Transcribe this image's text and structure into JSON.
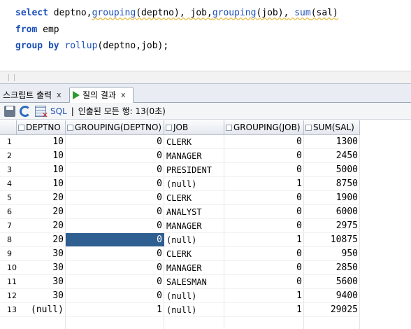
{
  "editor": {
    "line1": {
      "select": "select",
      "p1": " deptno,",
      "grouping1": "grouping",
      "p2": "(deptno),",
      "p3": " job,",
      "grouping2": "grouping",
      "p4": "(job),",
      "sum": " sum",
      "p5": "(sal)"
    },
    "line2": {
      "from": "from",
      "rest": " emp"
    },
    "line3": {
      "group_by": "group by",
      "rollup": " rollup",
      "rest": "(deptno,job);"
    }
  },
  "tabs": {
    "script_output": "스크립트 출력",
    "query_result": "질의 결과",
    "close": "x"
  },
  "toolbar": {
    "sql_label": "SQL",
    "separator": "|",
    "status": "인출된 모든 행: 13(0초)"
  },
  "grid": {
    "columns": [
      "DEPTNO",
      "GROUPING(DEPTNO)",
      "JOB",
      "GROUPING(JOB)",
      "SUM(SAL)"
    ],
    "rows": [
      {
        "n": "1",
        "deptno": "10",
        "gd": "0",
        "job": "CLERK",
        "gj": "0",
        "sum": "1300"
      },
      {
        "n": "2",
        "deptno": "10",
        "gd": "0",
        "job": "MANAGER",
        "gj": "0",
        "sum": "2450"
      },
      {
        "n": "3",
        "deptno": "10",
        "gd": "0",
        "job": "PRESIDENT",
        "gj": "0",
        "sum": "5000"
      },
      {
        "n": "4",
        "deptno": "10",
        "gd": "0",
        "job": "(null)",
        "gj": "1",
        "sum": "8750"
      },
      {
        "n": "5",
        "deptno": "20",
        "gd": "0",
        "job": "CLERK",
        "gj": "0",
        "sum": "1900"
      },
      {
        "n": "6",
        "deptno": "20",
        "gd": "0",
        "job": "ANALYST",
        "gj": "0",
        "sum": "6000"
      },
      {
        "n": "7",
        "deptno": "20",
        "gd": "0",
        "job": "MANAGER",
        "gj": "0",
        "sum": "2975"
      },
      {
        "n": "8",
        "deptno": "20",
        "gd": "0",
        "job": "(null)",
        "gj": "1",
        "sum": "10875"
      },
      {
        "n": "9",
        "deptno": "30",
        "gd": "0",
        "job": "CLERK",
        "gj": "0",
        "sum": "950"
      },
      {
        "n": "10",
        "deptno": "30",
        "gd": "0",
        "job": "MANAGER",
        "gj": "0",
        "sum": "2850"
      },
      {
        "n": "11",
        "deptno": "30",
        "gd": "0",
        "job": "SALESMAN",
        "gj": "0",
        "sum": "5600"
      },
      {
        "n": "12",
        "deptno": "30",
        "gd": "0",
        "job": "(null)",
        "gj": "1",
        "sum": "9400"
      },
      {
        "n": "13",
        "deptno": "(null)",
        "gd": "1",
        "job": "(null)",
        "gj": "1",
        "sum": "29025"
      }
    ],
    "selected_cell": {
      "row": 8,
      "column": "GROUPING(DEPTNO)"
    }
  },
  "colors": {
    "keyword": "#1c4fb8",
    "selection": "#2f5e91",
    "run_icon": "#2c9a2c"
  }
}
